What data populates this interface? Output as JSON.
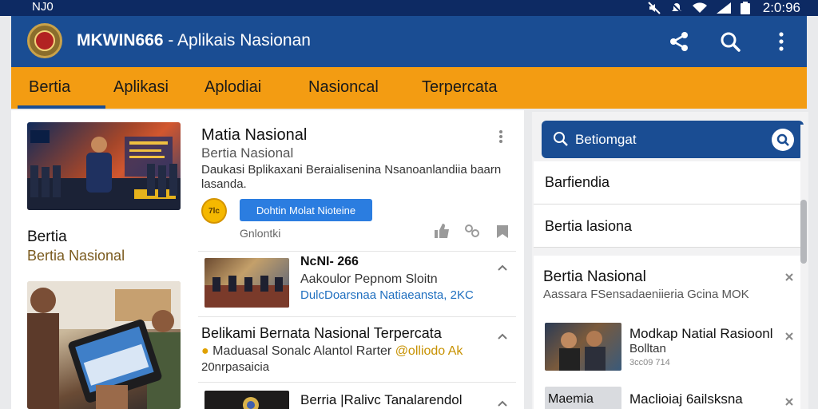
{
  "status_bar": {
    "carrier": "NJ0",
    "time": "2:0:96"
  },
  "app_bar": {
    "title_bold": "MKWIN666",
    "title_rest": " - Aplikais Nasionan"
  },
  "tabs": [
    "Bertia",
    "Aplikasi",
    "Aplodiai",
    "Nasioncal",
    "Terpercata"
  ],
  "left_column": {
    "label": "Bertia",
    "sublabel": "Bertia Nasional"
  },
  "featured": {
    "title": "Matia Nasional",
    "subtitle": "Bertia Nasional",
    "description": "Daukasi Bplikaxani Beraialisenina Nsanoanlandiia baarn lasanda.",
    "badge": "7lc",
    "button": "Dohtin Molat Nioteine",
    "meta": "Gnlontki"
  },
  "list": [
    {
      "title": "NcNI- 266",
      "line2": "Aakoulor Pepnom Sloitn",
      "line3": "DulcDoarsnaa Natiaeansta, 2KC"
    },
    {
      "title": "Belikami Bernata Nasional Terpercata",
      "line2": "Maduasal Sonalc Alantol Rarter",
      "line2_accent": "@olliodo Ak",
      "line3": "20nrpasaicia"
    },
    {
      "title": "Berria |Ralivc Tanalarendol"
    }
  ],
  "right_panel": {
    "search_value": "Betiomgat",
    "items": [
      "Barfiendia",
      "Bertia lasiona"
    ],
    "section_title": "Bertia Nasional",
    "section_sub": "Aassara FSensadaeniieria Gcina MOK",
    "item1_title": "Modkap Natial Rasioonl",
    "item1_sub": "Bolltan",
    "item1_meta": "3cc09        714",
    "item2_label": "Maemia",
    "item2_title": "Maclioiaj 6ailsksna"
  }
}
